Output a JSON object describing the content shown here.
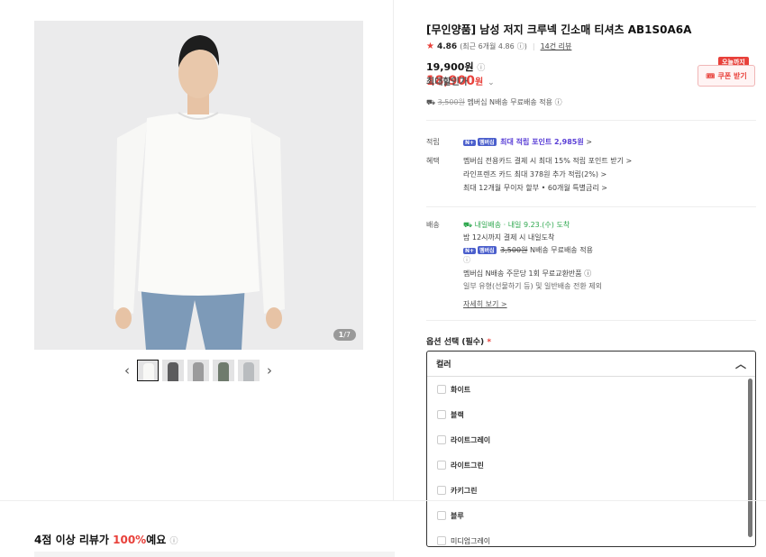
{
  "gallery": {
    "counter_current": "1",
    "counter_total": "/7",
    "prev_icon": "chevron-left-icon",
    "next_icon": "chevron-right-icon",
    "thumb_colors": [
      "#f4f4f2",
      "#5c5c5e",
      "#9b9b9c",
      "#6f7b6d",
      "#b9bcbf"
    ]
  },
  "product": {
    "title": "[무인양품] 남성 저지 크루넥 긴소매 티셔츠 AB1S0A6A",
    "rating": "4.86",
    "rating_recent": "(최근 6개월 4.86",
    "reviews": "14건 리뷰",
    "original_price": "19,900원",
    "sale_price_num": "18,900",
    "sale_price_unit": "원",
    "sale_label": "최대할인가",
    "shipping_fee": "3,500원",
    "shipping_text": "멤버십 N배송 무료배송 적용",
    "coupon_label": "쿠폰 받기",
    "coupon_tag": "오늘까지"
  },
  "accrual": {
    "label": "적립",
    "badge": "N+",
    "badge_text": "멤버십",
    "text": "최대 적립 포인트 2,985원",
    "chev": ">"
  },
  "benefits": {
    "label": "혜택",
    "lines": [
      "멤버십 전용카드 결제 시 최대 15% 적립 포인트 받기 >",
      "라인프렌즈 카드 최대 378원 추가 적립(2%) >",
      "최대 12개월 무이자 할부 • 60개월 특별금리 >"
    ]
  },
  "delivery": {
    "label": "배송",
    "tomorrow": "내일배송 · 내일 9.23.(수) 도착",
    "deadline": "밤 12시까지 결제 시 내일도착",
    "fee": "3,500원",
    "fee_text": "N배송 무료배송 적용",
    "exchange": "멤버십 N배송 주문당 1회 무료교환반품",
    "exclude": "일부 유형(선물하기 등) 및 일반배송 전환 제외",
    "more": "자세히 보기 >"
  },
  "options": {
    "title": "옵션 선택 (필수)",
    "required_mark": "*",
    "header": "컬러",
    "items": [
      "화이트",
      "블랙",
      "라이트그레이",
      "라이트그린",
      "카키그린",
      "블루",
      "미디엄그레이"
    ]
  },
  "reviews": {
    "prefix": "4점 이상 리뷰가 ",
    "percent": "100%",
    "suffix": "예요",
    "info_icon": "info-icon"
  },
  "colors": {
    "accent": "#e8403a",
    "point": "#5a3fd6",
    "green": "#2fa84f"
  }
}
